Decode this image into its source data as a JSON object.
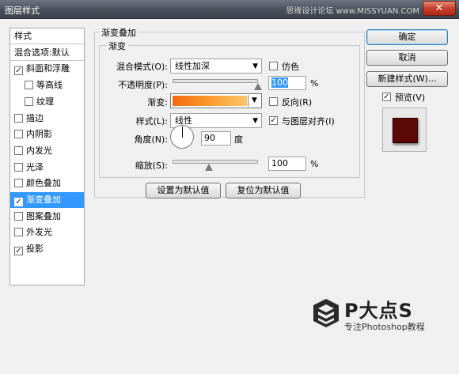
{
  "window": {
    "title": "图层样式",
    "watermark": "思缘设计论坛 www.MISSYUAN.COM",
    "close_glyph": "✕"
  },
  "style_list": {
    "items": [
      {
        "label": "样式",
        "checked": null,
        "selected": false,
        "sub": false,
        "head": true
      },
      {
        "label": "混合选项:默认",
        "checked": null,
        "selected": false,
        "sub": false,
        "head": true
      },
      {
        "label": "斜面和浮雕",
        "checked": true,
        "selected": false,
        "sub": false
      },
      {
        "label": "等高线",
        "checked": false,
        "selected": false,
        "sub": true
      },
      {
        "label": "纹理",
        "checked": false,
        "selected": false,
        "sub": true
      },
      {
        "label": "描边",
        "checked": false,
        "selected": false,
        "sub": false
      },
      {
        "label": "内阴影",
        "checked": false,
        "selected": false,
        "sub": false
      },
      {
        "label": "内发光",
        "checked": false,
        "selected": false,
        "sub": false
      },
      {
        "label": "光泽",
        "checked": false,
        "selected": false,
        "sub": false
      },
      {
        "label": "颜色叠加",
        "checked": false,
        "selected": false,
        "sub": false
      },
      {
        "label": "渐变叠加",
        "checked": true,
        "selected": true,
        "sub": false
      },
      {
        "label": "图案叠加",
        "checked": false,
        "selected": false,
        "sub": false
      },
      {
        "label": "外发光",
        "checked": false,
        "selected": false,
        "sub": false
      },
      {
        "label": "投影",
        "checked": true,
        "selected": false,
        "sub": false
      }
    ]
  },
  "panel": {
    "outer_title": "渐变叠加",
    "inner_title": "渐变",
    "blend_mode_label": "混合模式(O):",
    "blend_mode_value": "线性加深",
    "dither_label": "仿色",
    "dither_checked": false,
    "opacity_label": "不透明度(P):",
    "opacity_value": "100",
    "opacity_fraction": 1.0,
    "percent": "%",
    "gradient_label": "渐变:",
    "gradient_colors": [
      "#f26a10",
      "#fb9a2c",
      "#fcc66c"
    ],
    "reverse_label": "反向(R)",
    "reverse_checked": false,
    "style_label": "样式(L):",
    "style_value": "线性",
    "align_label": "与图层对齐(I)",
    "align_checked": true,
    "angle_label": "角度(N):",
    "angle_value": "90",
    "angle_unit": "度",
    "scale_label": "缩放(S):",
    "scale_value": "100",
    "scale_fraction": 0.43,
    "set_default_label": "设置为默认值",
    "reset_default_label": "复位为默认值"
  },
  "actions": {
    "ok_label": "确定",
    "cancel_label": "取消",
    "new_style_label": "新建样式(W)...",
    "preview_label": "预览(V)",
    "preview_checked": true,
    "preview_color": "#5c0806"
  },
  "brand": {
    "name": "P大点S",
    "tagline": "专注Photoshop教程"
  },
  "colors": {
    "selection": "#3399ff",
    "title_bar": "#4a505a",
    "close_button": "#c7402b"
  },
  "check_glyph": "✓",
  "dropdown_glyph": "▼"
}
